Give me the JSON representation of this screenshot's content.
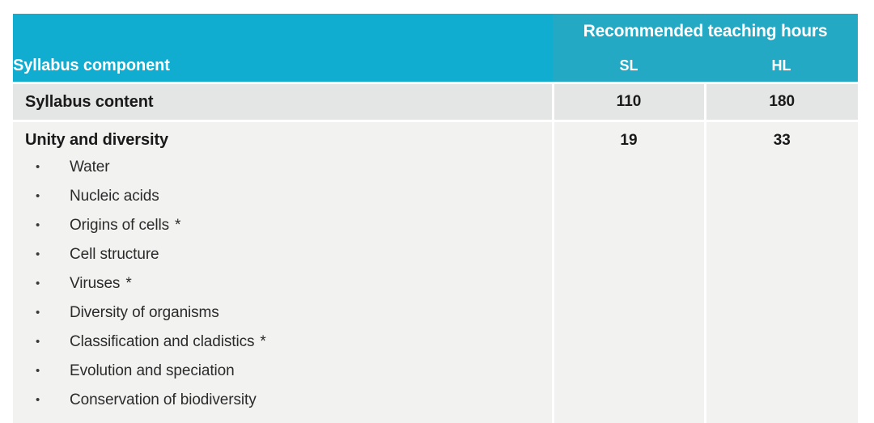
{
  "table": {
    "header": {
      "component_label": "Syllabus component",
      "recommended_label": "Recommended teaching hours",
      "sl_label": "SL",
      "hl_label": "HL"
    },
    "total_row": {
      "label": "Syllabus content",
      "sl": "110",
      "hl": "180"
    },
    "topic": {
      "title": "Unity and diversity",
      "sl": "19",
      "hl": "33",
      "items": [
        {
          "label": "Water",
          "star": ""
        },
        {
          "label": "Nucleic acids",
          "star": ""
        },
        {
          "label": "Origins of cells",
          "star": "*"
        },
        {
          "label": "Cell structure",
          "star": ""
        },
        {
          "label": "Viruses",
          "star": "*"
        },
        {
          "label": "Diversity of organisms",
          "star": ""
        },
        {
          "label": "Classification and cladistics",
          "star": "*"
        },
        {
          "label": "Evolution and speciation",
          "star": ""
        },
        {
          "label": "Conservation of biodiversity",
          "star": ""
        }
      ],
      "bullet_glyph": "•"
    }
  },
  "colors": {
    "header_left_cyan": "#10ADD1",
    "header_right_cyan": "#23A9C3",
    "header_divider": "#7EDCE8",
    "total_row_bg": "#E4E5E5",
    "body_row_bg": "#F2F2F1",
    "text_dark": "#1a1a1a"
  }
}
